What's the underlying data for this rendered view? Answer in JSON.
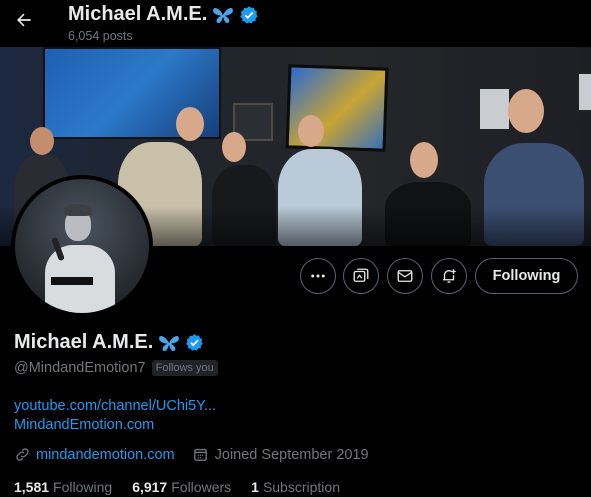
{
  "header": {
    "name": "Michael A.M.E.",
    "posts": "6,054 posts"
  },
  "profile": {
    "name": "Michael A.M.E.",
    "handle": "@MindandEmotion7",
    "follows_you": "Follows you",
    "bio_links": [
      "youtube.com/channel/UChi5Y...",
      "MindandEmotion.com"
    ],
    "website": "mindandemotion.com",
    "joined": "Joined September 2019",
    "stats": [
      {
        "number": "1,581",
        "label": "Following"
      },
      {
        "number": "6,917",
        "label": "Followers"
      },
      {
        "number": "1",
        "label": "Subscription"
      }
    ]
  },
  "actions": {
    "more": "more-icon",
    "grok": "grok-icon",
    "message": "mail-icon",
    "notify": "bell-plus-icon",
    "follow_label": "Following"
  },
  "colors": {
    "accent": "#1d9bf0",
    "verified": "#1d9bf0",
    "butterfly": "#4da3e8",
    "muted": "#71767b",
    "text": "#e7e9ea",
    "background": "#000000"
  }
}
